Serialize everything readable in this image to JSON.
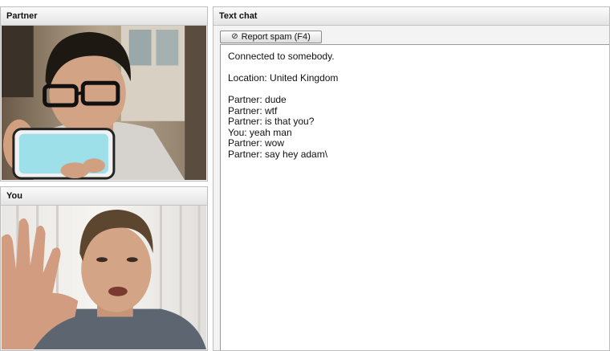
{
  "partner_panel": {
    "title": "Partner"
  },
  "you_panel": {
    "title": "You"
  },
  "chat_panel": {
    "title": "Text chat",
    "report_spam_label": "Report spam (F4)",
    "report_spam_icon": "no-entry-icon",
    "status": "Connected to somebody.",
    "location": "Location: United Kingdom",
    "messages": [
      "Partner: dude",
      "Partner: wtf",
      "Partner: is that you?",
      "You: yeah man",
      "Partner: wow",
      "Partner: say hey adam\\"
    ]
  }
}
